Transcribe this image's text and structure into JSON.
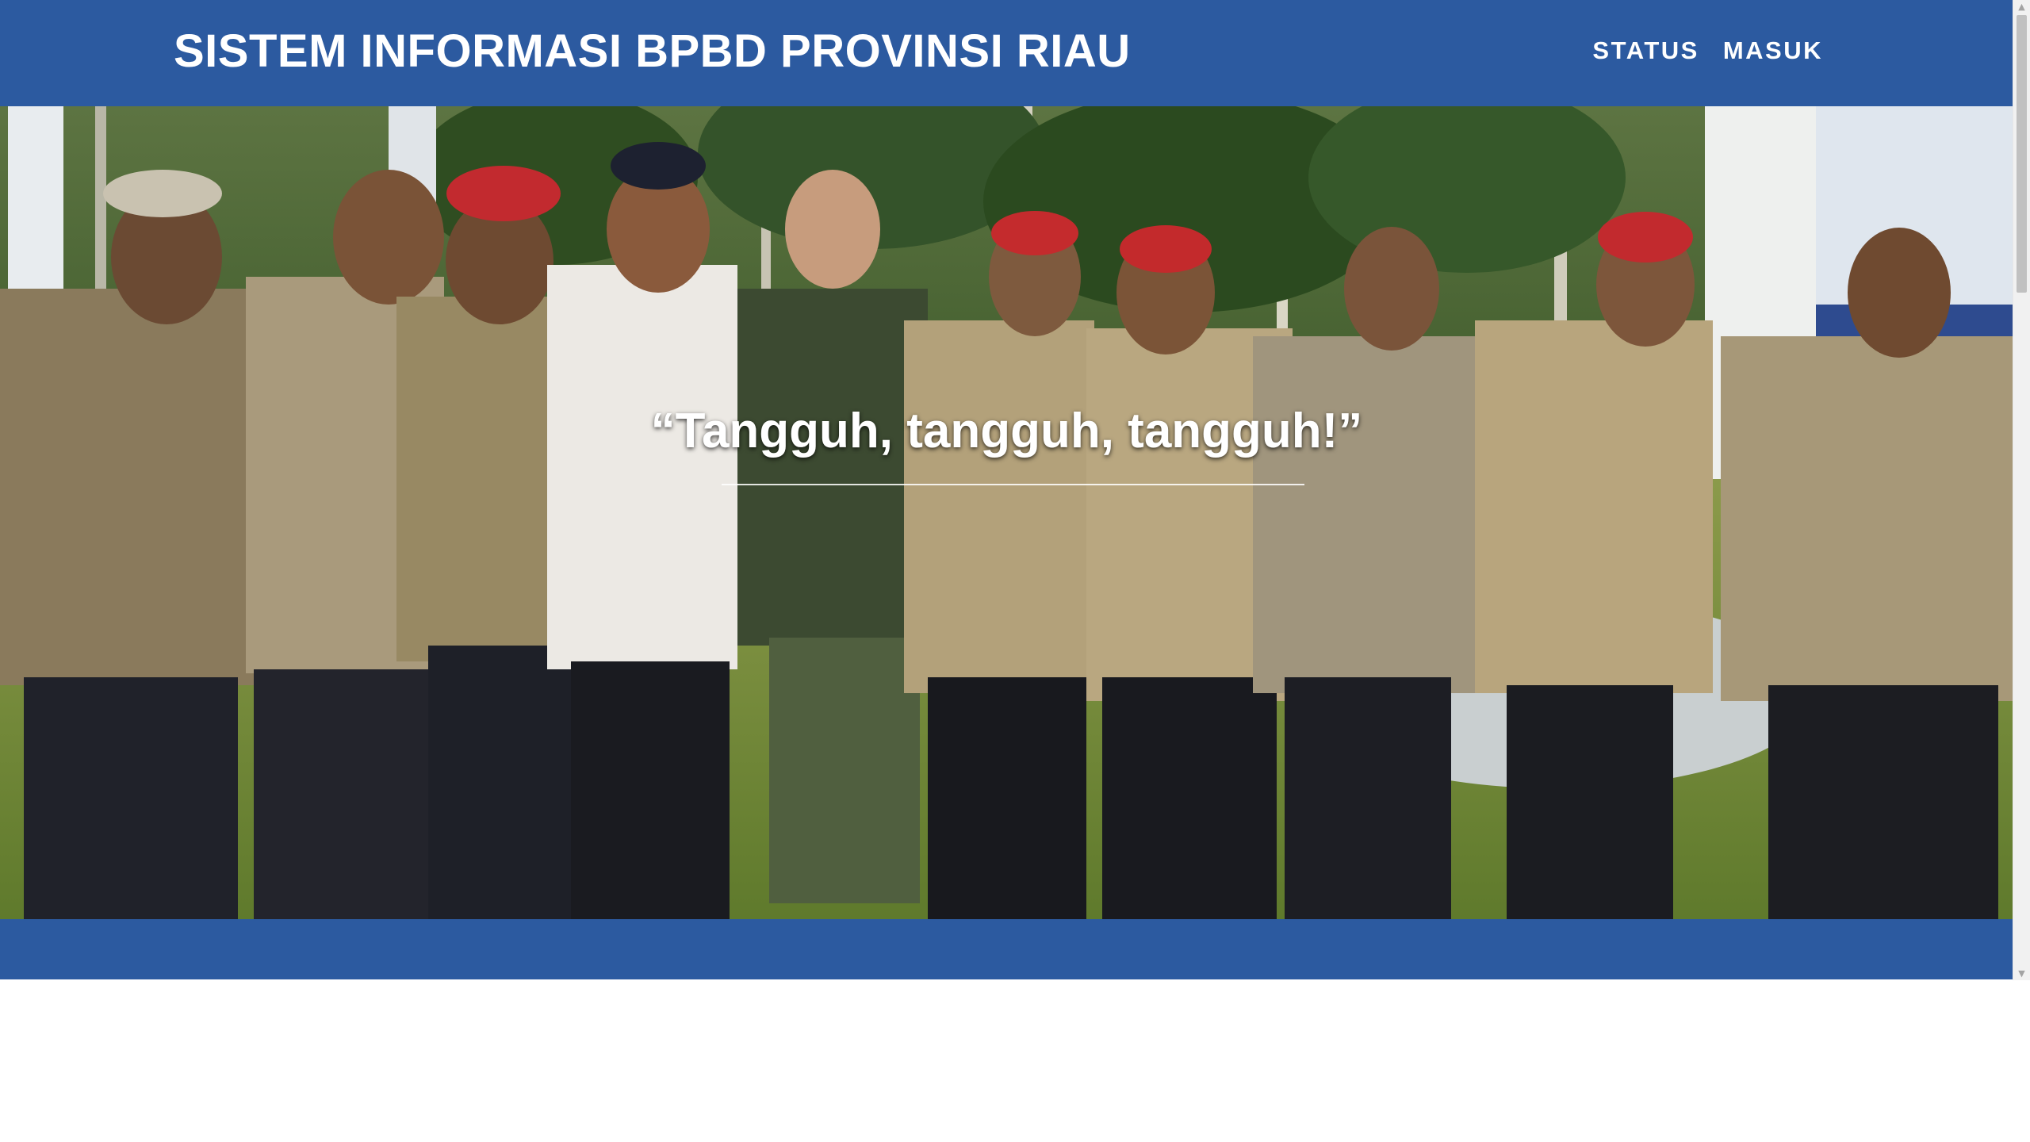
{
  "header": {
    "title": "SISTEM INFORMASI BPBD PROVINSI RIAU",
    "nav": [
      {
        "label": "STATUS"
      },
      {
        "label": "MASUK"
      }
    ]
  },
  "hero": {
    "quote": "“Tangguh, tangguh, tangguh!”",
    "image_desc": "group-photo-tagana-team-icon"
  },
  "colors": {
    "brand_blue": "#2c5aa0",
    "text": "#ffffff"
  },
  "scrollbar": {
    "up_icon": "triangle-up-icon",
    "down_icon": "triangle-down-icon"
  }
}
